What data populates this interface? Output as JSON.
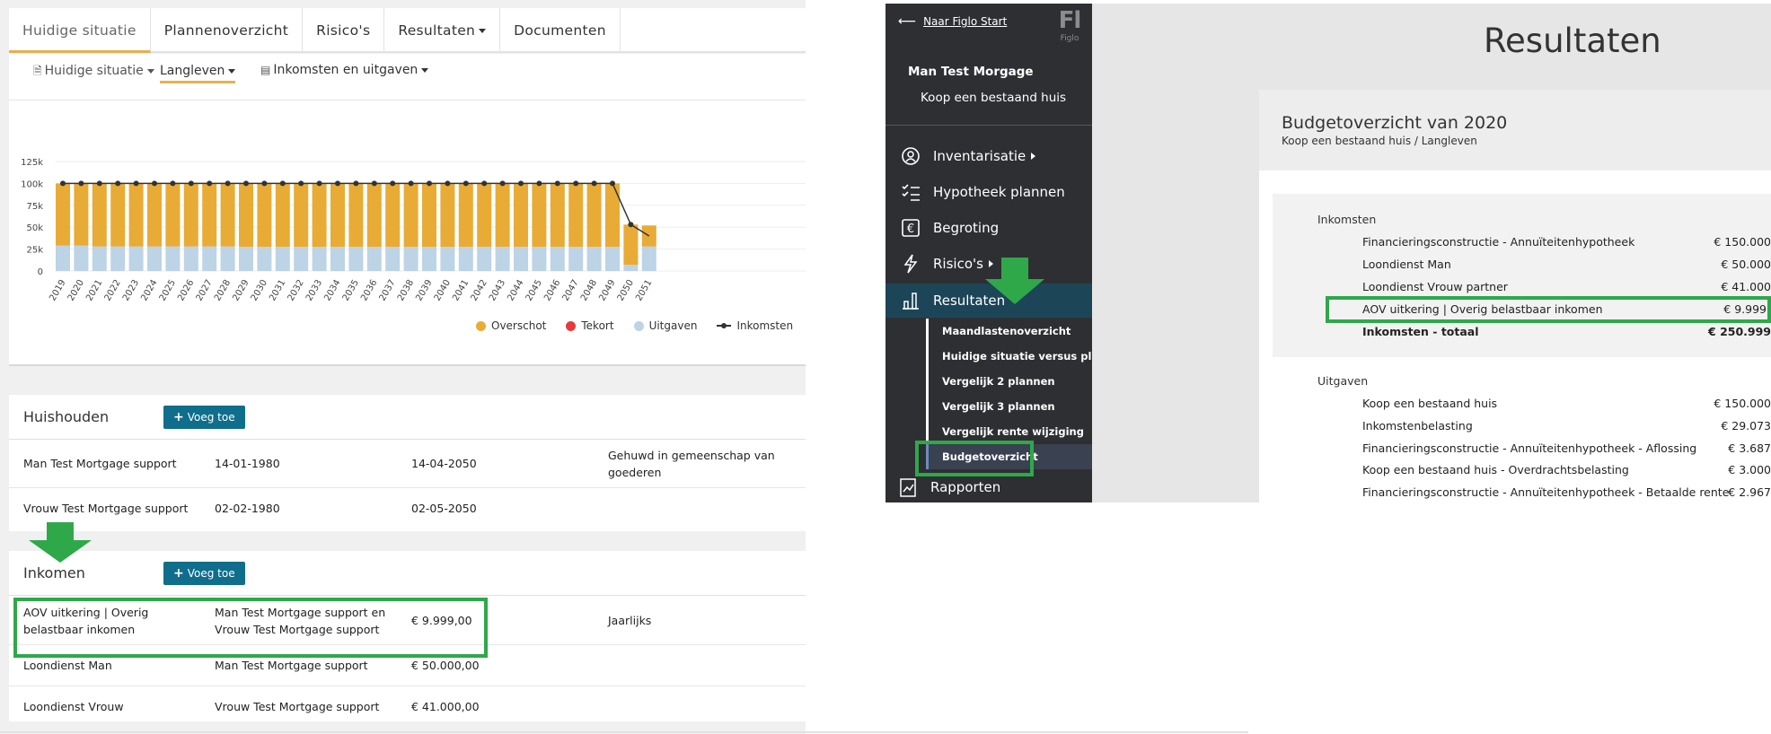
{
  "tabs": [
    "Huidige situatie",
    "Plannenoverzicht",
    "Risico's",
    "Resultaten",
    "Documenten"
  ],
  "subtoolbar": {
    "scenario": "Huidige situatie",
    "mode": "Langleven",
    "view": "Inkomsten en uitgaven"
  },
  "chart_data": {
    "type": "bar",
    "y_ticks": [
      "125k",
      "100k",
      "75k",
      "50k",
      "25k",
      "0"
    ],
    "ylim": [
      0,
      125000
    ],
    "categories": [
      "2019",
      "2020",
      "2021",
      "2022",
      "2023",
      "2024",
      "2025",
      "2026",
      "2027",
      "2028",
      "2029",
      "2030",
      "2031",
      "2032",
      "2033",
      "2034",
      "2035",
      "2036",
      "2037",
      "2038",
      "2039",
      "2040",
      "2041",
      "2042",
      "2043",
      "2044",
      "2045",
      "2046",
      "2047",
      "2048",
      "2049",
      "2050",
      "2051"
    ],
    "series": [
      {
        "name": "Uitgaven",
        "color": "#bdd3e6",
        "values": [
          29000,
          29000,
          28000,
          28000,
          28000,
          28000,
          28000,
          28000,
          28000,
          28000,
          27500,
          27500,
          27500,
          27500,
          27500,
          27500,
          27500,
          27500,
          27500,
          27500,
          27500,
          27500,
          27500,
          27500,
          27500,
          27500,
          27500,
          27500,
          27500,
          27500,
          27500,
          7000,
          28000
        ]
      },
      {
        "name": "Overschot",
        "color": "#e8ab36",
        "values": [
          71000,
          71000,
          72000,
          72000,
          72000,
          72000,
          72000,
          72000,
          72000,
          72000,
          72500,
          72500,
          72500,
          72500,
          72500,
          72500,
          72500,
          72500,
          72500,
          72500,
          72500,
          72500,
          72500,
          72500,
          72500,
          72500,
          72500,
          72500,
          72500,
          72500,
          72500,
          46000,
          24000
        ]
      },
      {
        "name": "Tekort",
        "color": "#e63b3b",
        "values": [
          0,
          0,
          0,
          0,
          0,
          0,
          0,
          0,
          0,
          0,
          0,
          0,
          0,
          0,
          0,
          0,
          0,
          0,
          0,
          0,
          0,
          0,
          0,
          0,
          0,
          0,
          0,
          0,
          0,
          0,
          0,
          0,
          0
        ]
      },
      {
        "name": "Inkomsten",
        "type": "line",
        "color": "#333333",
        "values": [
          100000,
          100000,
          100000,
          100000,
          100000,
          100000,
          100000,
          100000,
          100000,
          100000,
          100000,
          100000,
          100000,
          100000,
          100000,
          100000,
          100000,
          100000,
          100000,
          100000,
          100000,
          100000,
          100000,
          100000,
          100000,
          100000,
          100000,
          100000,
          100000,
          100000,
          100000,
          53000,
          40000
        ]
      }
    ],
    "legend": [
      "Overschot",
      "Tekort",
      "Uitgaven",
      "Inkomsten"
    ],
    "legend_colors": [
      "#e8ab36",
      "#e63b3b",
      "#bdd3e6",
      "#333333"
    ]
  },
  "huishouden": {
    "title": "Huishouden",
    "add_label": "Voeg toe",
    "rows": [
      {
        "name": "Man Test Mortgage support",
        "birth": "14-01-1980",
        "end": "14-04-2050",
        "note": "Gehuwd in gemeenschap van goederen"
      },
      {
        "name": "Vrouw Test Mortgage support",
        "birth": "02-02-1980",
        "end": "02-05-2050",
        "note": ""
      }
    ]
  },
  "inkomen": {
    "title": "Inkomen",
    "add_label": "Voeg toe",
    "rows": [
      {
        "name": "AOV uitkering | Overig belastbaar inkomen",
        "who": "Man Test Mortgage support en Vrouw Test Mortgage support",
        "amount": "€ 9.999,00",
        "freq": "Jaarlijks"
      },
      {
        "name": "Loondienst Man",
        "who": "Man Test Mortgage support",
        "amount": "€ 50.000,00",
        "freq": ""
      },
      {
        "name": "Loondienst Vrouw",
        "who": "Vrouw Test Mortgage support",
        "amount": "€ 41.000,00",
        "freq": ""
      }
    ]
  },
  "sidebar": {
    "back_label": "Naar Figlo Start",
    "logo_main": "Fl",
    "logo_sub": "Figlo",
    "client_name": "Man Test Morgage",
    "client_plan": "Koop een bestaand huis",
    "items": [
      {
        "label": "Inventarisatie",
        "icon": "user-search-icon"
      },
      {
        "label": "Hypotheek plannen",
        "icon": "checklist-icon"
      },
      {
        "label": "Begroting",
        "icon": "euro-icon"
      },
      {
        "label": "Risico's",
        "icon": "lightning-icon"
      },
      {
        "label": "Resultaten",
        "icon": "bar-chart-icon"
      }
    ],
    "sub_items": [
      "Maandlastenoverzicht",
      "Huidige situatie versus plan",
      "Vergelijk 2 plannen",
      "Vergelijk 3 plannen",
      "Vergelijk rente wijziging",
      "Budgetoverzicht"
    ],
    "bottom_item": "Rapporten"
  },
  "results": {
    "title": "Resultaten",
    "budget_title": "Budgetoverzicht van 2020",
    "budget_sub": "Koop een bestaand huis / Langleven",
    "income_label": "Inkomsten",
    "income_lines": [
      {
        "label": "Financieringsconstructie - Annuïteitenhypotheek",
        "value": "€ 150.000"
      },
      {
        "label": "Loondienst Man",
        "value": "€ 50.000"
      },
      {
        "label": "Loondienst Vrouw partner",
        "value": "€ 41.000"
      },
      {
        "label": "AOV uitkering | Overig belastbaar inkomen",
        "value": "€ 9.999"
      }
    ],
    "income_total": {
      "label": "Inkomsten - totaal",
      "value": "€ 250.999"
    },
    "expense_label": "Uitgaven",
    "expense_lines": [
      {
        "label": "Koop een bestaand huis",
        "value": "€ 150.000"
      },
      {
        "label": "Inkomstenbelasting",
        "value": "€ 29.073"
      },
      {
        "label": "Financieringsconstructie - Annuïteitenhypotheek - Aflossing",
        "value": "€ 3.687"
      },
      {
        "label": "Koop een bestaand huis - Overdrachtsbelasting",
        "value": "€ 3.000"
      },
      {
        "label": "Financieringsconstructie - Annuïteitenhypotheek - Betaalde rente",
        "value": "€ 2.967"
      }
    ]
  },
  "colors": {
    "accent": "#e8b04e",
    "highlight": "#2fa84a",
    "button": "#0f6e8c",
    "sidebar_bg": "#2e2f33",
    "sidebar_active": "#1d4558"
  }
}
